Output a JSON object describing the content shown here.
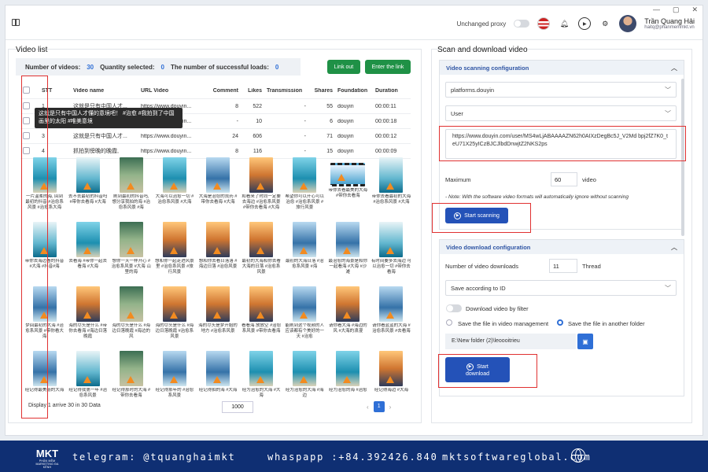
{
  "header": {
    "unchanged_proxy": "Unchanged proxy",
    "user_name": "Trần Quang Hải",
    "user_email": "haitq@phanmemmkt.vn",
    "window_controls": [
      "—",
      "▢",
      "✕"
    ]
  },
  "video_list": {
    "title": "Video list",
    "stats": {
      "count_label": "Number of videos:",
      "count_value": "30",
      "selected_label": "Quantity selected:",
      "selected_value": "0",
      "loads_label": "The number of successful loads:",
      "loads_value": "0"
    },
    "link_out": "Link out",
    "enter_link": "Enter the link",
    "columns": [
      "STT",
      "Video name",
      "URL Video",
      "Comment",
      "Likes",
      "Transmission",
      "Shares",
      "Foundation",
      "Duration"
    ],
    "rows": [
      {
        "stt": "1",
        "name": "这就是只有中国人才...",
        "url": "https://www.douyin...",
        "comment": "8",
        "likes": "522",
        "trans": "-",
        "shares": "55",
        "found": "douyin",
        "dur": "00:00:11"
      },
      {
        "stt": "2",
        "name": "这就是只有中国人才...",
        "url": "https://www.douyin...",
        "comment": "-",
        "likes": "10",
        "trans": "-",
        "shares": "6",
        "found": "douyin",
        "dur": "00:00:18"
      },
      {
        "stt": "3",
        "name": "这就是只有中国人才...",
        "url": "https://www.douyin...",
        "comment": "24",
        "likes": "606",
        "trans": "-",
        "shares": "71",
        "found": "douyin",
        "dur": "00:00:12"
      },
      {
        "stt": "4",
        "name": "抓拍到傍晚的晚霞,",
        "url": "https://www.douyin...",
        "comment": "8",
        "likes": "116",
        "trans": "-",
        "shares": "15",
        "found": "douyin",
        "dur": "00:00:09"
      }
    ],
    "tooltip": "这就是只有中国人才懂的意境吧！ #治愈 #我拍到了中国画里的太阳 #唯美意境",
    "captions": [
      "一片温柔的海, 回到最初的抖音 #治愈系风景 #治愈系大海",
      "去不去最初的抖音吗 #带你去看海 #大海",
      "刷到最初的抖音吗, 想分享我拍的海 #治愈系风景 #海",
      "大海可以治愈一切 #治愈系风景 #大海",
      "大海是治愈的良药 #带你去看海 #大海",
      "和看来了时同一定要去海边 #治愈系风景 #带你去看海 #大海",
      "希望你可以开心可以治愈 #治愈系风景 #旅行风景",
      "带你去看最美的大海 #带你去看海",
      "带你去看最初的大海 #治愈系风景 #大海",
      "带你去海边看的抖音 #大海 #抖音#海",
      "去看海 #带你一起去看海 #大海",
      "想你一天一样开心 #治愈系风景 #大海 山里的海",
      "想和你一起走进风景里 #治愈系风景 #旅行风景",
      "想和你去看日落落 #海边日落 #治愈风景",
      "最初的大海和你去看大海的日落 #治愈系风景",
      "最初的大海日落 #治愈系风景 #海",
      "最治愈的海景是和你一起看海 #大海 #沙滩",
      "有时间要多去海边 可以治愈一切 #带你去看海",
      "梦回最初的大海 #治愈系风景 #带你看大海",
      "海的尽头是什么 #带你去看海 #海边日落晚霞",
      "海的尽头是什么 #海边日落晚霞 #海边的风",
      "海的尽头是什么 #海边日落晚霞 #治愈系风景",
      "海的尽头是梦开始的地方 #治愈系风景",
      "看看海 放放空 #治愈系风景 #带你去看海",
      "能刷到这个视频的人应该都有个美好的一天 #治愈",
      "请你看大海 #海边的风 #大海的浪漫",
      "请你看蓝蓝的大海 #治愈系风景 #去看海",
      "经记得最美丽的大海",
      "经记得我第一年 #治愈系风景",
      "经记得那时的大海 #带你去看海",
      "经记得那年的 #治愈系风景",
      "经记得拍的海 #大海",
      "经为治愈的大海 #大海",
      "经为治愈的大海 #海边",
      "经为治愈的海 #治愈",
      "经记得海边 #大海"
    ],
    "footer_display": "Display 1 arrive 30 in 30 Data",
    "page_size": "1000",
    "current_page": "1"
  },
  "scan": {
    "title": "Scan and download video",
    "scan_config_title": "Video scanning configuration",
    "platform": "platforms.douyin",
    "type": "User",
    "url_value": "https://www.douyin.com/user/MS4wLjABAAAAZN62h0AIXzDegBc5J_V2Md bpj2fZ7K0_teU71X25yICzBJCJlbdDnwjtZ2NKS2ps",
    "maximum_label": "Maximum",
    "maximum_value": "60",
    "video_unit": "video",
    "note": "- Note: With the software video formats will automatically ignore without scanning",
    "start_scanning": "Start scanning"
  },
  "download": {
    "title": "Video download configuration",
    "num_label": "Number of video downloads",
    "num_value": "11",
    "thread_label": "Thread",
    "save_mode": "Save according to ID",
    "filter_label": "Download video by filter",
    "opt_in_mgmt": "Save the file in video management",
    "opt_other": "Save the file in another folder",
    "folder_path": "E:\\New folder (2)\\leoooitrieu",
    "start_download_1": "Start",
    "start_download_2": "download"
  },
  "banner": {
    "logo": "MKT",
    "logo_sub": "PHẦN MỀM MARKETING ĐA KÊNH",
    "telegram": "telegram: @tquanghaimkt",
    "whatsapp": "whaspapp :+84.392426.840",
    "website": "mktsoftwareglobal.com"
  },
  "colors": {
    "accent": "#2f6fd6",
    "green": "#1f9146",
    "highlight": "#e03131",
    "banner": "#0f2f73"
  }
}
